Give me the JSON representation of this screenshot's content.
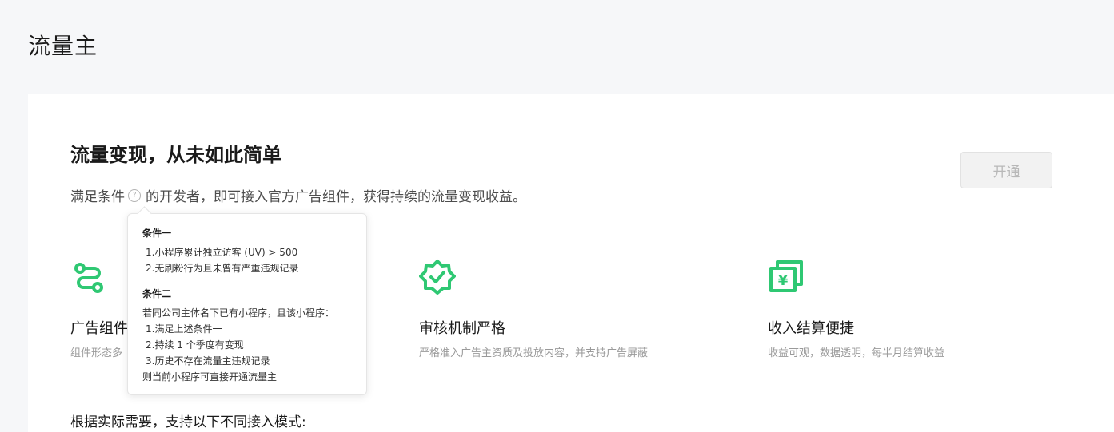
{
  "page": {
    "title": "流量主"
  },
  "hero": {
    "title": "流量变现，从未如此简单",
    "desc_before": "满足条件",
    "desc_after": "的开发者，即可接入官方广告组件，获得持续的流量变现收益。",
    "help_glyph": "?",
    "open_button": "开通"
  },
  "features": [
    {
      "icon": "ad-component-icon",
      "title": "广告组件",
      "desc": "组件形态多"
    },
    {
      "icon": "verified-badge-icon",
      "title": "审核机制严格",
      "desc": "严格准入广告主资质及投放内容，并支持广告屏蔽"
    },
    {
      "icon": "money-bills-icon",
      "title": "收入结算便捷",
      "desc": "收益可观，数据透明，每半月结算收益"
    }
  ],
  "modes_intro": "根据实际需要，支持以下不同接入模式:",
  "tooltip": {
    "cond1_title": "条件一",
    "cond1_items": [
      "1.小程序累计独立访客 (UV) > 500",
      "2.无刷粉行为且未曾有严重违规记录"
    ],
    "cond2_title": "条件二",
    "cond2_intro": "若同公司主体名下已有小程序，且该小程序：",
    "cond2_items": [
      "1.满足上述条件一",
      "2.持续 1 个季度有变现",
      "3.历史不存在流量主违规记录"
    ],
    "cond2_outro": "则当前小程序可直接开通流量主"
  },
  "colors": {
    "accent": "#2fc873",
    "background": "#f6f7f9"
  }
}
